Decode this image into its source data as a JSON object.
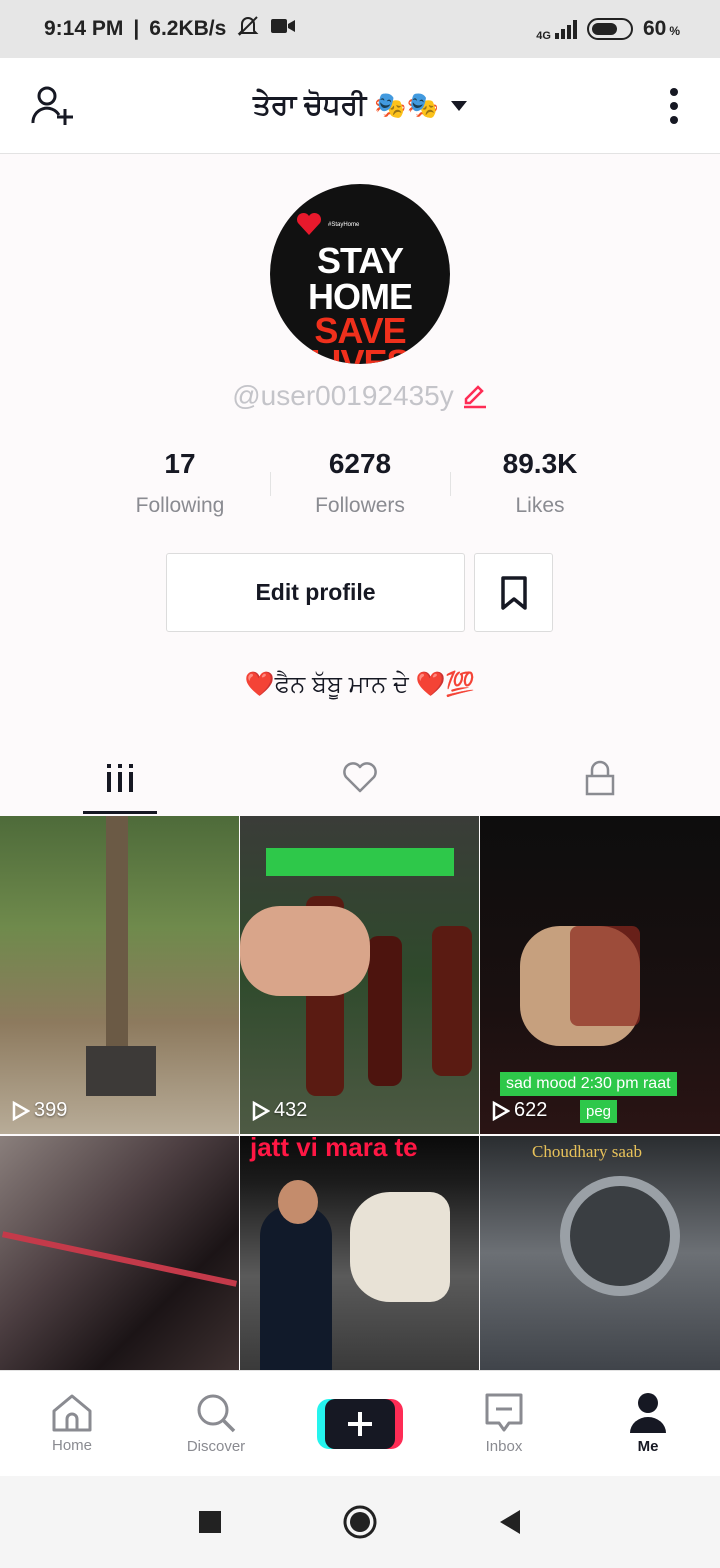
{
  "status_bar": {
    "time": "9:14 PM",
    "speed": "6.2KB/s",
    "network": "4G",
    "battery": "60",
    "battery_unit": "%"
  },
  "header": {
    "title": "ਤੇਰਾ ਚੋਧਰੀ",
    "title_emoji": "🎭🎭"
  },
  "profile": {
    "avatar_text": [
      "STAY",
      "HOME",
      "SAVE",
      "LIVES"
    ],
    "avatar_small": "#StayHome",
    "username": "@user00192435y",
    "stats": [
      {
        "value": "17",
        "label": "Following"
      },
      {
        "value": "6278",
        "label": "Followers"
      },
      {
        "value": "89.3K",
        "label": "Likes"
      }
    ],
    "edit_label": "Edit profile",
    "bio": "❤️ਫੈਨ ਬੱਬੂ ਮਾਨ ਦੇ ❤️💯"
  },
  "videos": [
    {
      "views": "399",
      "overlay": ""
    },
    {
      "views": "432",
      "overlay": ""
    },
    {
      "views": "622",
      "overlay": "sad mood 2:30 pm raat",
      "overlay2": "peg"
    },
    {
      "views": "",
      "overlay": ""
    },
    {
      "views": "",
      "overlay": "jatt vi mara te"
    },
    {
      "views": "",
      "overlay": "Choudhary saab"
    }
  ],
  "nav": {
    "home": "Home",
    "discover": "Discover",
    "inbox": "Inbox",
    "me": "Me"
  },
  "colors": {
    "accent_pink": "#fe2c55",
    "accent_cyan": "#25f4ee",
    "text": "#161823",
    "muted": "#8a8b91"
  }
}
